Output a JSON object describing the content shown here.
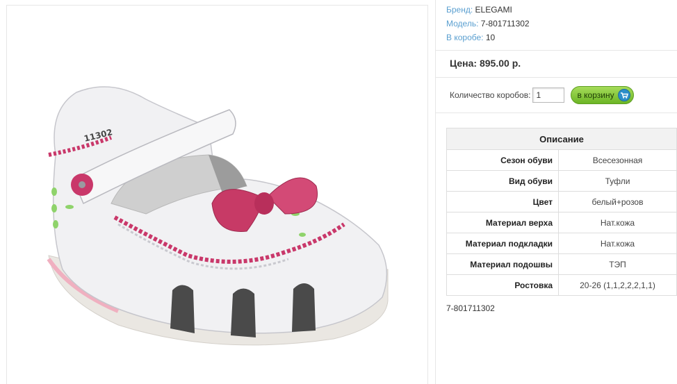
{
  "product": {
    "image_alt": "shoe-photo",
    "brand_label": "Бренд:",
    "brand_value": "ELEGAMI",
    "model_label": "Модель:",
    "model_value": "7-801711302",
    "box_label": "В коробе:",
    "box_value": "10",
    "price": "Цена: 895.00 р.",
    "sku": "7-801711302"
  },
  "order": {
    "qty_label": "Количество коробов:",
    "qty_value": "1",
    "cart_button": "в корзину"
  },
  "description": {
    "title": "Описание",
    "rows": [
      {
        "key": "Сезон обуви",
        "value": "Всесезонная"
      },
      {
        "key": "Вид обуви",
        "value": "Туфли"
      },
      {
        "key": "Цвет",
        "value": "белый+розов"
      },
      {
        "key": "Материал верха",
        "value": "Нат.кожа"
      },
      {
        "key": "Материал подкладки",
        "value": "Нат.кожа"
      },
      {
        "key": "Материал подошвы",
        "value": "ТЭП"
      },
      {
        "key": "Ростовка",
        "value": "20-26 (1,1,2,2,2,1,1)"
      }
    ]
  },
  "colors": {
    "link_blue": "#5a9fd0",
    "button_green": "#7cc234",
    "accent_pink": "#c9386a"
  }
}
